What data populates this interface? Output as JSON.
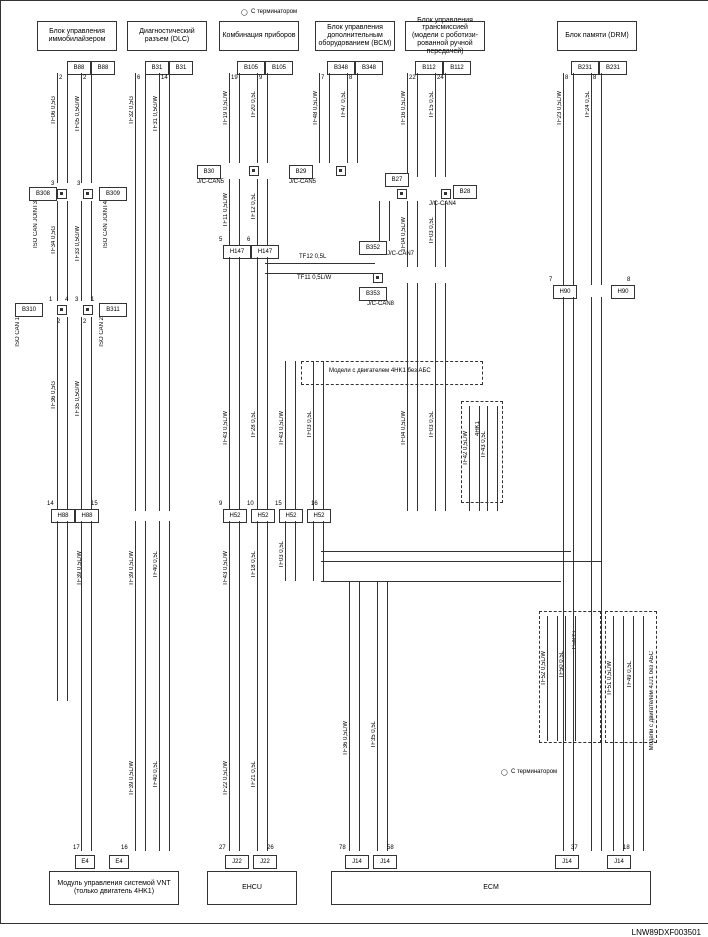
{
  "hdr": {
    "term1": "С терминатором",
    "term2": "С терминатором",
    "b1": "Блок управления иммобилайзером",
    "b2": "Диагностический разъем (DLC)",
    "b3": "Комбинация приборов",
    "b4": "Блок управления дополнительным оборудованием (BCM)",
    "b5": "Блок управления трансмиссией (модели с роботизи-рованной ручной передачей)",
    "b6": "Блок памяти (DRM)"
  },
  "c": {
    "b88a": "B88",
    "b88b": "B88",
    "b31a": "B31",
    "b31b": "B31",
    "b105a": "B105",
    "b105b": "B105",
    "b348a": "B348",
    "b348b": "B348",
    "b112a": "B112",
    "b112b": "B112",
    "b231a": "B231",
    "b231b": "B231",
    "b308": "B308",
    "b309": "B309",
    "b30": "B30",
    "b29": "B29",
    "b27": "B27",
    "b28": "B28",
    "b352": "B352",
    "b353": "B353",
    "b310": "B310",
    "b311": "B311",
    "h147a": "H147",
    "h147b": "H147",
    "h90a": "H90",
    "h90b": "H90",
    "h88a": "H88",
    "h88b": "H88",
    "h52a": "H52",
    "h52b": "H52",
    "h52c": "H52",
    "h52d": "H52",
    "e4a": "E4",
    "e4b": "E4",
    "j22a": "J22",
    "j22b": "J22",
    "j14a": "J14",
    "j14b": "J14",
    "j14c": "J14",
    "j14d": "J14"
  },
  "w": {
    "tf06": "TF06 0,5G",
    "tf05": "TF05 0,5G/W",
    "tf32": "TF32 0,5G",
    "tf31": "TF31 0,5G/W",
    "tf19": "TF19 0,5L/W",
    "tf20": "TF20 0,5L",
    "tf48": "TF48 0,5L/W",
    "tf47": "TF47 0,5L",
    "tf16": "TF16 0,5L/W",
    "tf15": "TF15 0,5L",
    "tf23": "TF23 0,5L/W",
    "tf24": "TF24 0,5L",
    "tf34": "TF34 0,5G",
    "tf33": "TF33 0,5G/W",
    "tf11": "TF11 0,5L/W",
    "tf12": "TF12 0,5L",
    "tf04": "TF04 0,5L/W",
    "tf03": "TF03 0,5L",
    "tf36": "TF36 0,5G",
    "tf35": "TF35 0,5G/W",
    "tf39": "TF39 0,5L/W",
    "tf40": "TF40 0,5L",
    "tf43": "TF43 0,5L/W",
    "tf28": "TF28 0,5L",
    "tf03b": "TF03 0,5L",
    "tf18": "TF18 0,5L",
    "tf42": "TF42 0,5L/W",
    "tf43b": "TF43 0,5L",
    "tf51": "TF51 0,5L/W",
    "tf50": "TF50 0,5L",
    "tf52": "TF52 0,5L/W",
    "tf49": "TF49 0,5L",
    "tf22": "TF22 0,5L/W",
    "tf21": "TF21 0,5L",
    "tf36b": "TF36 0,5L/W",
    "tf35b": "TF35 0,5L",
    "tf12l": "TF12 0,5L",
    "tf11l": "TF11 0,5L/W"
  },
  "lbl": {
    "isocan1": "ISO CAN 1",
    "isocan2": "ISO CAN 2",
    "isoj3": "ISO CAN JOINT3",
    "isoj4": "ISO CAN JOINT4",
    "jccan5": "J/C-CAN5",
    "jccan4": "J/C-CAN4",
    "jccan7": "J/C-CAN7",
    "jccan8": "J/C-CAN8",
    "note1": "Модели с двигателем 4HK1 без АБС",
    "note2": "4HK1",
    "cabs": "C-ABS",
    "note3": "Модели с двигателем 4JJ1 без АБС",
    "vnt": "Модуль управления системой VNT (только двигатель 4HK1)",
    "ehcu": "EHCU",
    "ecm": "ECM",
    "circ": "◯",
    "foot": "LNW89DXF003501"
  },
  "p": {
    "p1": "1",
    "p2": "2",
    "p3": "3",
    "p4": "4",
    "p5": "5",
    "p6": "6",
    "p7": "7",
    "p8": "8",
    "p9": "9",
    "p10": "10",
    "p14": "14",
    "p15": "15",
    "p16": "16",
    "p17": "17",
    "p18": "18",
    "p19": "19",
    "p22": "22",
    "p24": "24",
    "p26": "26",
    "p27": "27",
    "p37": "37",
    "p58": "58",
    "p78": "78"
  }
}
